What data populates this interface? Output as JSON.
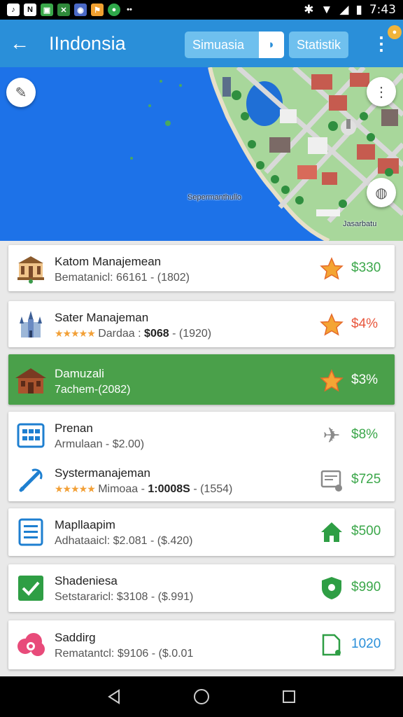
{
  "status_bar": {
    "time": "7:43",
    "notification_icons": [
      "note-icon",
      "n-icon",
      "image-icon",
      "x-icon",
      "photo-icon",
      "flag-icon",
      "chat-icon",
      "more-dots"
    ],
    "system_icons": [
      "bluetooth-icon",
      "wifi-icon",
      "signal-icon",
      "battery-icon"
    ]
  },
  "app_bar": {
    "back_icon": "arrow-left-icon",
    "title": "IIndonsia",
    "chip_simulasi": "Simuasia",
    "chip_statistik": "Statistik",
    "overflow_icon": "more-vert-icon"
  },
  "map": {
    "label_sea": "Sepermanthullo",
    "label_coast": "Jasarbatu",
    "colors": {
      "sea": "#1d72e8",
      "land": "#a8d79b",
      "roads": "#d9d9d9"
    }
  },
  "list": [
    {
      "icon": "museum-icon",
      "title": "Katom Manajemean",
      "subtitle": "Bematanicl: 66161 - (1802)",
      "badge": "star-icon",
      "value": "$330",
      "value_color": "green"
    },
    {
      "icon": "cathedral-icon",
      "title": "Sater Manajeman",
      "stars": "★★★★★",
      "subtitle_pre": "Dardaa :",
      "subtitle_bold": "$068",
      "subtitle_post": "- (1920)",
      "badge": "star-icon",
      "value": "$4%",
      "value_color": "red"
    },
    {
      "icon": "house-icon",
      "title": "Damuzali",
      "subtitle": "7achem-(2082)",
      "badge": "star-icon",
      "value": "$3%",
      "highlight": true
    },
    {
      "icon": "table-icon",
      "title": "Prenan",
      "subtitle": "Armulaan - $2.00)",
      "badge": "airplane-icon",
      "value": "$8%",
      "value_color": "green"
    },
    {
      "icon": "pin-icon",
      "title": "Systermanajeman",
      "stars": "★★★★★",
      "subtitle_pre": "Mimoaa -",
      "subtitle_bold": "1:0008S",
      "subtitle_post": "- (1554)",
      "badge": "monitor-icon",
      "value": "$725",
      "value_color": "green"
    },
    {
      "icon": "list-icon",
      "title": "Mapllaapim",
      "subtitle": "Adhataaicl: $2.081 - ($.420)",
      "badge": "home-icon",
      "value": "$500",
      "value_color": "green"
    },
    {
      "icon": "check-icon",
      "title": "Shadeniesa",
      "subtitle": "Setstararicl: $3108 - ($.991)",
      "badge": "shield-icon",
      "value": "$990",
      "value_color": "green"
    },
    {
      "icon": "cloud-icon",
      "title": "Saddirg",
      "subtitle": "Rematantcl: $9106 - ($.0.01",
      "badge": "document-icon",
      "value": "1020",
      "value_color": "blue"
    }
  ],
  "nav_bar": {
    "back_icon": "triangle-back-icon",
    "home_icon": "circle-home-icon",
    "recents_icon": "square-recents-icon"
  }
}
